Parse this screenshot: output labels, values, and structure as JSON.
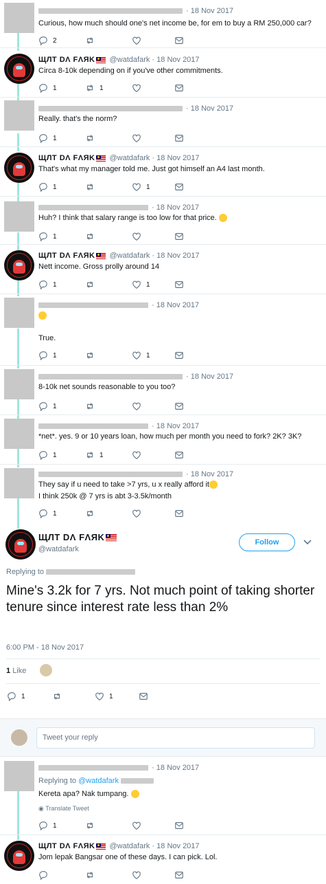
{
  "tweets": [
    {
      "name": "",
      "handle": "",
      "date": "18 Nov 2017",
      "text": [
        "Curious, how much should one's net income be, for em to buy a RM 250,000 car?"
      ],
      "replies": "2",
      "retweets": "",
      "likes": ""
    },
    {
      "name": "ЩЛТ DΛ FΛЯK",
      "handle": "@watdafark",
      "date": "18 Nov 2017",
      "text": [
        "Circa 8-10k depending on if you've other commitments."
      ],
      "replies": "1",
      "retweets": "1",
      "likes": ""
    },
    {
      "name": "",
      "handle": "",
      "date": "18 Nov 2017",
      "text": [
        "Really. that's the norm?"
      ],
      "replies": "1",
      "retweets": "",
      "likes": ""
    },
    {
      "name": "ЩЛТ DΛ FΛЯK",
      "handle": "@watdafark",
      "date": "18 Nov 2017",
      "text": [
        "That's what my manager told me. Just got himself an A4 last month."
      ],
      "replies": "1",
      "retweets": "",
      "likes": "1"
    },
    {
      "name": "",
      "handle": "",
      "date": "18 Nov 2017",
      "text": [
        "Huh? I think that salary range is too low for that price."
      ],
      "replies": "1",
      "retweets": "",
      "likes": ""
    },
    {
      "name": "ЩЛТ DΛ FΛЯK",
      "handle": "@watdafark",
      "date": "18 Nov 2017",
      "text": [
        "Nett income. Gross prolly around 14"
      ],
      "replies": "1",
      "retweets": "",
      "likes": "1"
    },
    {
      "name": "",
      "handle": "",
      "date": "18 Nov 2017",
      "text": [
        "",
        "True."
      ],
      "replies": "1",
      "retweets": "",
      "likes": "1"
    },
    {
      "name": "",
      "handle": "",
      "date": "18 Nov 2017",
      "text": [
        "8-10k net sounds reasonable to you too?"
      ],
      "replies": "1",
      "retweets": "",
      "likes": ""
    },
    {
      "name": "",
      "handle": "",
      "date": "18 Nov 2017",
      "text": [
        "*net*. yes. 9 or 10 years loan, how much per month you need to fork? 2K? 3K?"
      ],
      "replies": "1",
      "retweets": "1",
      "likes": ""
    },
    {
      "name": "",
      "handle": "",
      "date": "18 Nov 2017",
      "text": [
        "They say if u need to take >7 yrs, u x really afford it",
        "I think 250k @ 7 yrs is abt 3-3.5k/month"
      ],
      "replies": "1",
      "retweets": "",
      "likes": ""
    }
  ],
  "main": {
    "name": "ЩЛТ DΛ FΛЯK",
    "handle": "@watdafark",
    "follow_label": "Follow",
    "replying_to": "Replying to",
    "text": "Mine's 3.2k for 7 yrs. Not much point of taking shorter tenure since interest rate less than 2%",
    "timestamp": "6:00 PM - 18 Nov 2017",
    "likes_count": "1",
    "likes_label": "Like",
    "replies": "1",
    "likes": "1"
  },
  "reply_box": {
    "placeholder": "Tweet your reply"
  },
  "replies_below": [
    {
      "date": "18 Nov 2017",
      "replying_to": "Replying to",
      "mention": "@watdafark",
      "text": "Kereta apa? Nak tumpang.",
      "translate": "Translate Tweet",
      "replies": "1"
    },
    {
      "name": "ЩЛТ DΛ FΛЯK",
      "handle": "@watdafark",
      "date": "18 Nov 2017",
      "text": "Jom lepak Bangsar one of these days. I can pick. Lol."
    }
  ],
  "colors": {
    "accent": "#1da1f2",
    "thread_line": "#9fe6dc",
    "muted": "#657786"
  }
}
